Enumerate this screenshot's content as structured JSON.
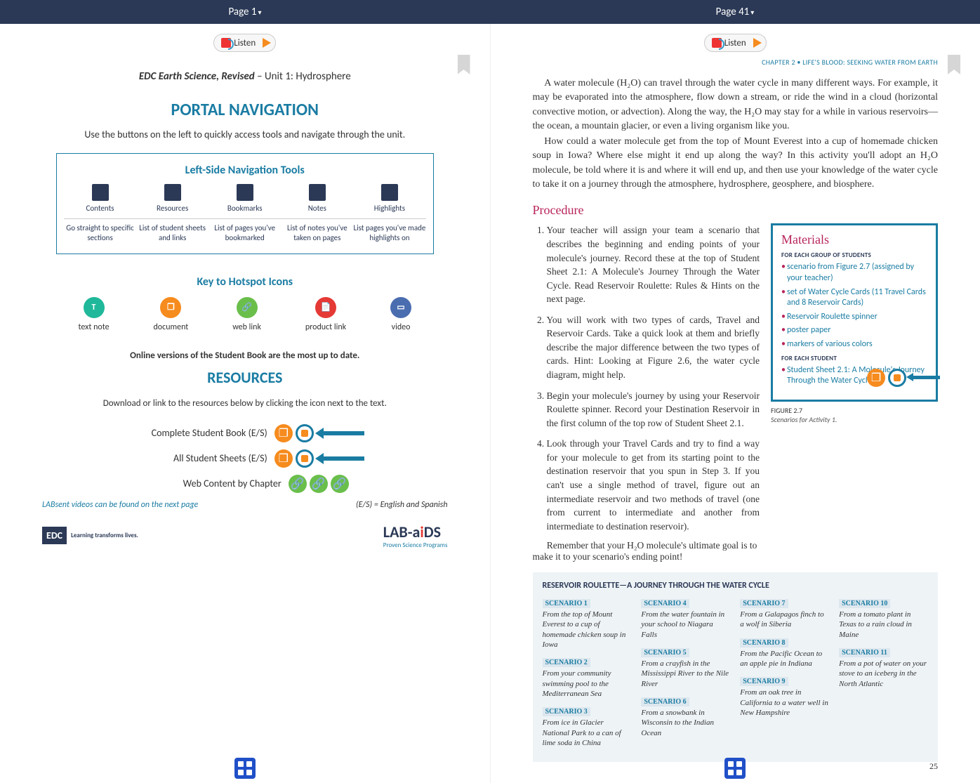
{
  "topbar": {
    "left": "Page 1",
    "right": "Page 41"
  },
  "listen_label": "Listen",
  "page1": {
    "title_italic": "EDC Earth Science, Revised",
    "title_rest": " – Unit 1: Hydrosphere",
    "h_portal": "PORTAL NAVIGATION",
    "intro": "Use the buttons on the left to quickly access tools and navigate through the unit.",
    "nav_title": "Left-Side Navigation Tools",
    "nav_cols": [
      {
        "label": "Contents",
        "desc": "Go straight to specific sections"
      },
      {
        "label": "Resources",
        "desc": "List of student sheets and links"
      },
      {
        "label": "Bookmarks",
        "desc": "List of pages you've bookmarked"
      },
      {
        "label": "Notes",
        "desc": "List of notes you've taken on pages"
      },
      {
        "label": "Highlights",
        "desc": "List pages you've made highlights on"
      }
    ],
    "key_title": "Key to Hotspot Icons",
    "key_items": [
      {
        "label": "text note",
        "glyph": "T",
        "cls": "c-teal"
      },
      {
        "label": "document",
        "glyph": "❐",
        "cls": "c-orange"
      },
      {
        "label": "web link",
        "glyph": "🔗",
        "cls": "c-green"
      },
      {
        "label": "product link",
        "glyph": "📄",
        "cls": "c-red"
      },
      {
        "label": "video",
        "glyph": "▭",
        "cls": "c-blue"
      }
    ],
    "note": "Online versions of the Student Book are the most up to date.",
    "h_res": "RESOURCES",
    "res_intro": "Download or link to the resources below by clicking the icon next to the text.",
    "res_rows": [
      {
        "label": "Complete Student Book (E/S)",
        "arrow": true,
        "icons": [
          "o",
          "t"
        ]
      },
      {
        "label": "All Student Sheets (E/S)",
        "arrow": true,
        "icons": [
          "o",
          "t"
        ]
      },
      {
        "label": "Web Content by Chapter",
        "arrow": false,
        "icons": [
          "g",
          "g",
          "g"
        ]
      }
    ],
    "foot_lab": "LABsent videos can be found on the next page",
    "foot_es": "(E/S) = English and Spanish",
    "edc": "EDC",
    "edc_tag": "Learning transforms lives.",
    "labaids": "LAB-aiDS",
    "labaids_sub": "Proven Science Programs"
  },
  "page41": {
    "chapter": "CHAPTER 2 • LIFE'S BLOOD: SEEKING WATER FROM EARTH",
    "para1": "A water molecule (H₂O) can travel through the water cycle in many different ways. For example, it may be evaporated into the atmosphere, flow down a stream, or ride the wind in a cloud (horizontal convective motion, or advection). Along the way, the H₂O may stay for a while in various reservoirs—the ocean, a mountain glacier, or even a living organism like you.",
    "para2": "How could a water molecule get from the top of Mount Everest into a cup of homemade chicken soup in Iowa? Where else might it end up along the way? In this activity you'll adopt an H₂O molecule, be told where it is and where it will end up, and then use your knowledge of the water cycle to take it on a journey through the atmosphere, hydrosphere, geosphere, and biosphere.",
    "proc_h": "Procedure",
    "steps": [
      "Your teacher will assign your team a scenario that describes the beginning and ending points of your molecule's journey. Record these at the top of Student Sheet 2.1: A Molecule's Journey Through the Water Cycle. Read Reservoir Roulette: Rules & Hints on the next page.",
      "You will work with two types of cards, Travel and Reservoir Cards. Take a quick look at them and briefly describe the major difference between the two types of cards. Hint: Looking at Figure 2.6, the water cycle diagram, might help.",
      "Begin your molecule's journey by using your Reservoir Roulette spinner. Record your Destination Reservoir in the first column of the top row of Student Sheet 2.1.",
      "Look through your Travel Cards and try to find a way for your molecule to get from its starting point to the destination reservoir that you spun in Step 3. If you can't use a single method of travel, figure out an intermediate reservoir and two methods of travel (one from current to intermediate and another from intermediate to destination reservoir)."
    ],
    "remember": "Remember that your H₂O molecule's ultimate goal is to make it to your scenario's ending point!",
    "mat_h": "Materials",
    "mat_sub1": "FOR EACH GROUP OF STUDENTS",
    "mat_group": [
      "scenario from Figure 2.7 (assigned by your teacher)",
      "set of Water Cycle Cards (11 Travel Cards and 8 Reservoir Cards)",
      "Reservoir Roulette spinner",
      "poster paper",
      "markers of various colors"
    ],
    "mat_sub2": "FOR EACH STUDENT",
    "mat_student": [
      "Student Sheet 2.1: A Molecule's Journey Through the Water Cycle"
    ],
    "fig_t": "FIGURE 2.7",
    "fig_d": "Scenarios for Activity 1.",
    "scen_h": "RESERVOIR ROULETTE—A JOURNEY THROUGH THE WATER CYCLE",
    "scenarios": [
      [
        {
          "t": "SCENARIO 1",
          "d": "From the top of Mount Everest to a cup of homemade chicken soup in Iowa"
        },
        {
          "t": "SCENARIO 2",
          "d": "From your community swimming pool to the Mediterranean Sea"
        },
        {
          "t": "SCENARIO 3",
          "d": "From ice in Glacier National Park to a can of lime soda in China"
        }
      ],
      [
        {
          "t": "SCENARIO 4",
          "d": "From the water fountain in your school to Niagara Falls"
        },
        {
          "t": "SCENARIO 5",
          "d": "From a crayfish in the Mississippi River to the Nile River"
        },
        {
          "t": "SCENARIO 6",
          "d": "From a snowbank in Wisconsin to the Indian Ocean"
        }
      ],
      [
        {
          "t": "SCENARIO 7",
          "d": "From a Galapagos finch to a wolf in Siberia"
        },
        {
          "t": "SCENARIO 8",
          "d": "From the Pacific Ocean to an apple pie in Indiana"
        },
        {
          "t": "SCENARIO 9",
          "d": "From an oak tree in California to a water well in New Hampshire"
        }
      ],
      [
        {
          "t": "SCENARIO 10",
          "d": "From a tomato plant in Texas to a rain cloud in Maine"
        },
        {
          "t": "SCENARIO 11",
          "d": "From a pot of water on your stove to an iceberg in the North Atlantic"
        }
      ]
    ],
    "pgnum": "25"
  }
}
